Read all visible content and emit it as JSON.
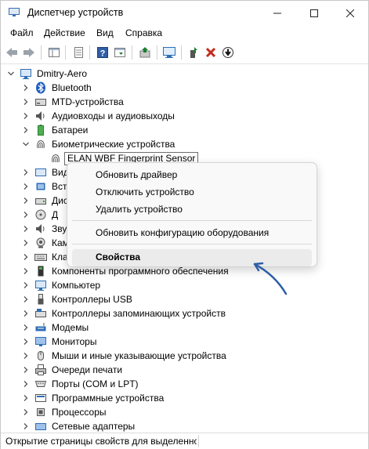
{
  "window": {
    "title": "Диспетчер устройств"
  },
  "menu": {
    "file": "Файл",
    "action": "Действие",
    "view": "Вид",
    "help": "Справка"
  },
  "tree": {
    "root": "Dmitry-Aero",
    "bluetooth": "Bluetooth",
    "mtd": "MTD-устройства",
    "audio_io": "Аудиовходы и аудиовыходы",
    "batteries": "Батареи",
    "biometric": "Биометрические устройства",
    "biometric_child": "ELAN WBF Fingerprint Sensor",
    "video_partial": "Вид",
    "embedded_partial": "Вст",
    "disk_partial": "Дис",
    "sound_partial": "Звук",
    "dvd_partial": "Д",
    "camera_partial": "Кам",
    "keyboard_partial": "Кла",
    "software_components": "Компоненты программного обеспечения",
    "computer": "Компьютер",
    "usb": "Контроллеры USB",
    "storage": "Контроллеры запоминающих устройств",
    "modems": "Модемы",
    "monitors": "Мониторы",
    "mice": "Мыши и иные указывающие устройства",
    "print_queue": "Очереди печати",
    "ports": "Порты (COM и LPT)",
    "software_devices": "Программные устройства",
    "processors": "Процессоры",
    "network": "Сетевые адаптеры"
  },
  "context_menu": {
    "update_driver": "Обновить драйвер",
    "disable_device": "Отключить устройство",
    "uninstall_device": "Удалить устройство",
    "scan_hardware": "Обновить конфигурацию оборудования",
    "properties": "Свойства"
  },
  "status": {
    "text": "Открытие страницы свойств для выделенного объекта."
  },
  "colors": {
    "accent": "#2e6db4",
    "arrow": "#2f5fa7",
    "delete": "#c42b1c",
    "scan": "#1a7f2e"
  }
}
